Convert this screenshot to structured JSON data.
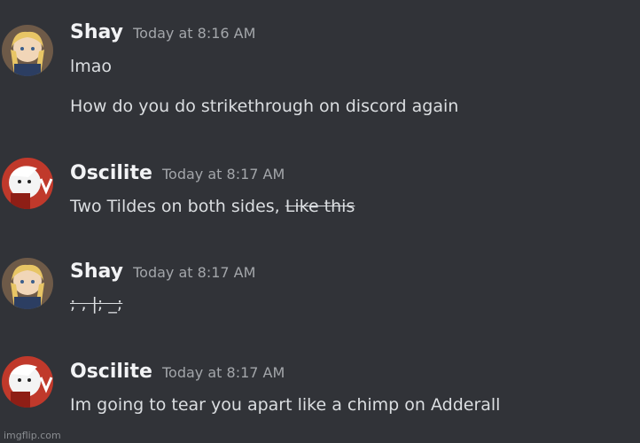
{
  "messages": [
    {
      "username": "Shay",
      "timestamp": "Today at 8:16 AM",
      "avatar_icon": "shay-avatar-icon",
      "lines": [
        "lmao",
        "How do you do strikethrough on discord again"
      ]
    },
    {
      "username": "Oscilite",
      "timestamp": "Today at 8:17 AM",
      "avatar_icon": "oscilite-avatar-icon",
      "text_plain": "Two Tildes on both sides, ",
      "text_strike": "Like this"
    },
    {
      "username": "Shay",
      "timestamp": "Today at 8:17 AM",
      "avatar_icon": "shay-avatar-icon",
      "text_strike": "; , |; _;"
    },
    {
      "username": "Oscilite",
      "timestamp": "Today at 8:17 AM",
      "avatar_icon": "oscilite-avatar-icon",
      "text": "Im going to tear you apart like a chimp on Adderall"
    }
  ],
  "watermark": "imgflip.com",
  "colors": {
    "background": "#313338",
    "username": "#f2f3f5",
    "timestamp": "#a3a6aa",
    "message_text": "#dbdee1",
    "oscilite_avatar_red": "#c0392b"
  }
}
